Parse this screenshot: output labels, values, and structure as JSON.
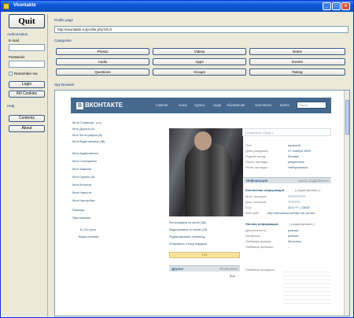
{
  "window": {
    "title": "Vkontakte"
  },
  "sidebar": {
    "quit_label": "Quit",
    "auth_heading": "Authorization",
    "email_label": "E-mail",
    "email_value": "",
    "password_label": "Password",
    "password_value": "",
    "remember_label": "Remember me",
    "remember_checked": false,
    "login_label": "Login",
    "kill_cookies_label": "Kill Cookies",
    "help_heading": "Help",
    "contents_label": "Contents",
    "about_label": "About"
  },
  "main": {
    "profile_page_label": "Profile page",
    "profile_url": "http://vkontakte.ru/profile.php?id=0",
    "categories_label": "Categories",
    "categories": [
      [
        "Photos",
        "Videos",
        "Notes"
      ],
      [
        "Audio",
        "Apps",
        "Events"
      ],
      [
        "Questions",
        "Groups",
        "Rating"
      ]
    ],
    "spy_browser_label": "Spy Browser"
  },
  "vk": {
    "logo": "ВКОНТАКТЕ",
    "logo_mark": "В",
    "nav": [
      "главная",
      "поиск",
      "группы",
      "люди",
      "объявления",
      "пригласить",
      "выйти"
    ],
    "search_placeholder": "Поиск",
    "left_menu": [
      {
        "label": "Моя Страница",
        "count": "ред."
      },
      {
        "label": "Мои Друзья (4)",
        "count": ""
      },
      {
        "label": "Мои Фотографии (8)",
        "count": ""
      },
      {
        "label": "Мои Видеозаписи (38)",
        "count": ""
      },
      {
        "label": "Мои Аудиозаписи",
        "count": ""
      },
      {
        "label": "Мои Сообщения",
        "count": ""
      },
      {
        "label": "Мои Заметки",
        "count": ""
      },
      {
        "label": "Мои Группы (6)",
        "count": ""
      },
      {
        "label": "Мои Встречи",
        "count": ""
      },
      {
        "label": "Мои Новости",
        "count": ""
      },
      {
        "label": "Мои Настройки",
        "count": ""
      },
      {
        "label": "Помощь",
        "count": ""
      },
      {
        "label": "Приложения",
        "count": ""
      }
    ],
    "left_extra": [
      "В 12ч утра",
      "Ваше резюме"
    ],
    "photo_links": [
      "Фотографии со мной (38)",
      "Видеозаписи со мной (18)",
      "Редактировать страницу",
      "Отправить Стасу подарок"
    ],
    "rating": "173",
    "friends_header": "Друзья",
    "friends_count": "объявление",
    "friends_all": "Все",
    "status_placeholder": "[ Изменить статус ]",
    "basic_info": [
      [
        "Пол:",
        "мужской"
      ],
      [
        "День рождения:",
        "27 ноября 1999"
      ],
      [
        "Родной город:",
        "Москва"
      ],
      [
        "Полит. взгляды:",
        "умеренные"
      ],
      [
        "Религ. взгляды:",
        "Нейтральные"
      ]
    ],
    "info_header": "Информация",
    "info_edit": "скрыть подробности",
    "contact_header": "Контактная информация:",
    "contact_edit": "[ редактировать ]",
    "contact_info": [
      [
        "Моб. телефон:",
        "??????????"
      ],
      [
        "Дом. телефон:",
        "???????"
      ],
      [
        "ICQ:",
        "33 6 *** | 13831"
      ],
      [
        "Веб-сайт:",
        "http://dimadroid.ru/http://vk.ab.info"
      ]
    ],
    "personal_header": "Личная информация:",
    "personal_edit": "[ редактировать ]",
    "personal_info": [
      [
        "Деятельность:",
        "разные"
      ],
      [
        "Интересы:",
        "разные"
      ],
      [
        "Любимая музыка:",
        "Металлы"
      ],
      [
        "Любимые фильмы:",
        "..."
      ]
    ],
    "fav_shows": "Любимые передачи:"
  }
}
